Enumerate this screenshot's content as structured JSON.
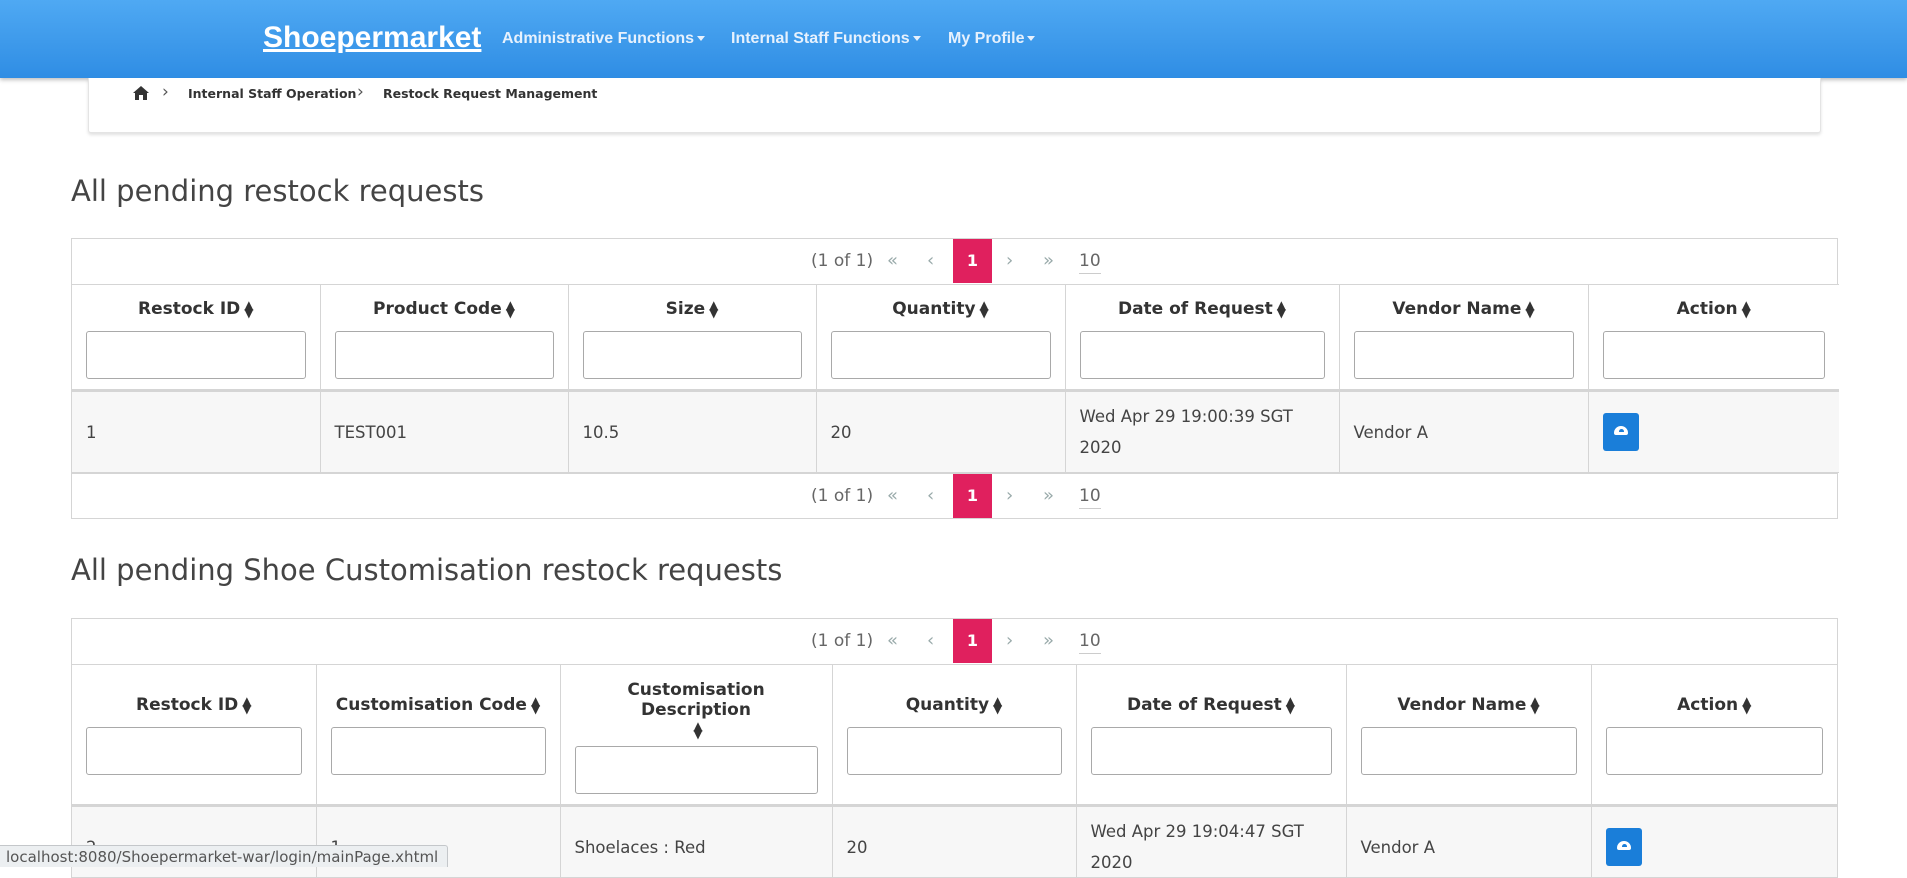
{
  "app": {
    "brand": "Shoepermarket"
  },
  "nav": [
    {
      "label": "Administrative Functions"
    },
    {
      "label": "Internal Staff Functions"
    },
    {
      "label": "My Profile"
    }
  ],
  "breadcrumb": {
    "items": [
      "Internal Staff Operation",
      "Restock Request Management"
    ]
  },
  "section1": {
    "title": "All pending restock requests",
    "pager": {
      "report": "(1 of 1)",
      "first": "«",
      "prev": "‹",
      "page": "1",
      "next": "›",
      "last": "»",
      "rows": "10"
    },
    "columns": [
      "Restock ID",
      "Product Code",
      "Size",
      "Quantity",
      "Date of Request",
      "Vendor Name",
      "Action"
    ],
    "rows": [
      {
        "id": "1",
        "code": "TEST001",
        "size": "10.5",
        "qty": "20",
        "date": "Wed Apr 29 19:00:39 SGT 2020",
        "vendor": "Vendor A"
      }
    ]
  },
  "section2": {
    "title": "All pending Shoe Customisation restock requests",
    "pager": {
      "report": "(1 of 1)",
      "first": "«",
      "prev": "‹",
      "page": "1",
      "next": "›",
      "last": "»",
      "rows": "10"
    },
    "columns": [
      "Restock ID",
      "Customisation Code",
      "Customisation Description",
      "Quantity",
      "Date of Request",
      "Vendor Name",
      "Action"
    ],
    "rows": [
      {
        "id": "2",
        "code": "1",
        "desc": "Shoelaces : Red",
        "qty": "20",
        "date": "Wed Apr 29 19:04:47 SGT 2020",
        "vendor": "Vendor A"
      }
    ]
  },
  "status": {
    "url": "localhost:8080/Shoepermarket-war/login/mainPage.xhtml"
  },
  "icons": {
    "home": "home-icon",
    "sort": "sort-icon",
    "action": "inbox-icon"
  }
}
